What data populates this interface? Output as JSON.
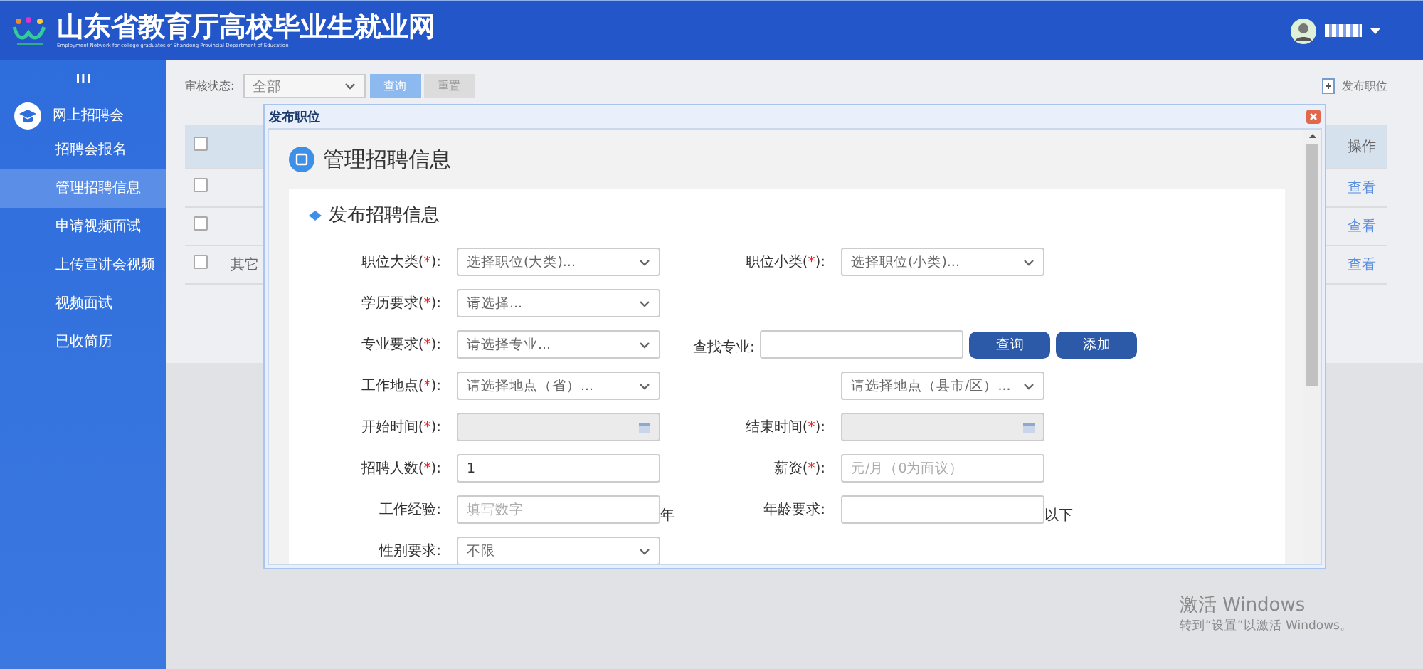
{
  "header": {
    "title": "山东省教育厅高校毕业生就业网",
    "subtitle": "Employment Network for college graduates of Shandong Provincial Department of Education"
  },
  "sidebar": {
    "section": "网上招聘会",
    "items": [
      {
        "label": "招聘会报名",
        "selected": false
      },
      {
        "label": "管理招聘信息",
        "selected": true
      },
      {
        "label": "申请视频面试",
        "selected": false
      },
      {
        "label": "上传宣讲会视频",
        "selected": false
      },
      {
        "label": "视频面试",
        "selected": false
      },
      {
        "label": "已收简历",
        "selected": false
      }
    ]
  },
  "toolbar": {
    "filter_label": "审核状态:",
    "filter_value": "全部",
    "query_button": "查询",
    "reset_button": "重置",
    "publish_link": "发布职位"
  },
  "table": {
    "header": {
      "checked": false,
      "action": "操作"
    },
    "rows": [
      {
        "checked": false,
        "action": "查看"
      },
      {
        "checked": false,
        "action": "查看"
      },
      {
        "checked": false,
        "name": "其它",
        "action": "查看"
      }
    ]
  },
  "dialog": {
    "title": "发布职位",
    "heading": "管理招聘信息",
    "section": "发布招聘信息",
    "rows": [
      {
        "left": {
          "kind": "select",
          "label": "职位大类(",
          "asterisk": "*",
          "label_tail": "):",
          "value": "选择职位(大类)..."
        },
        "right": {
          "kind": "select",
          "label": "职位小类(",
          "asterisk": "*",
          "label_tail": "):",
          "value": "选择职位(小类)..."
        }
      },
      {
        "left": {
          "kind": "select",
          "label": "学历要求(",
          "asterisk": "*",
          "label_tail": "):",
          "value": "请选择..."
        }
      },
      {
        "left": {
          "kind": "select",
          "label": "专业要求(",
          "asterisk": "*",
          "label_tail": "):",
          "value": "请选择专业..."
        },
        "right": {
          "kind": "search",
          "label": "查找专业:",
          "buttons": [
            "查询",
            "添加"
          ]
        }
      },
      {
        "left": {
          "kind": "select",
          "label": "工作地点(",
          "asterisk": "*",
          "label_tail": "):",
          "value": "请选择地点（省）..."
        },
        "right": {
          "kind": "select",
          "value": "请选择地点（县市/区）..."
        }
      },
      {
        "left": {
          "kind": "date",
          "label": "开始时间(",
          "asterisk": "*",
          "label_tail": "):"
        },
        "right": {
          "kind": "date",
          "label": "结束时间(",
          "asterisk": "*",
          "label_tail": "):"
        }
      },
      {
        "left": {
          "kind": "text",
          "label": "招聘人数(",
          "asterisk": "*",
          "label_tail": "):",
          "value": "1"
        },
        "right": {
          "kind": "text",
          "label": "薪资(",
          "asterisk": "*",
          "label_tail": "):",
          "placeholder": "元/月（0为面议）"
        }
      },
      {
        "left": {
          "kind": "text",
          "label": "工作经验:",
          "placeholder": "填写数字",
          "suffix": "年"
        },
        "right": {
          "kind": "text",
          "label": "年龄要求:",
          "suffix": "以下"
        }
      },
      {
        "left": {
          "kind": "select",
          "label": "性别要求:",
          "value": "不限"
        }
      }
    ]
  },
  "activation_notice": {
    "title": "激活 Windows",
    "text": "转到“设置”以激活 Windows。"
  }
}
